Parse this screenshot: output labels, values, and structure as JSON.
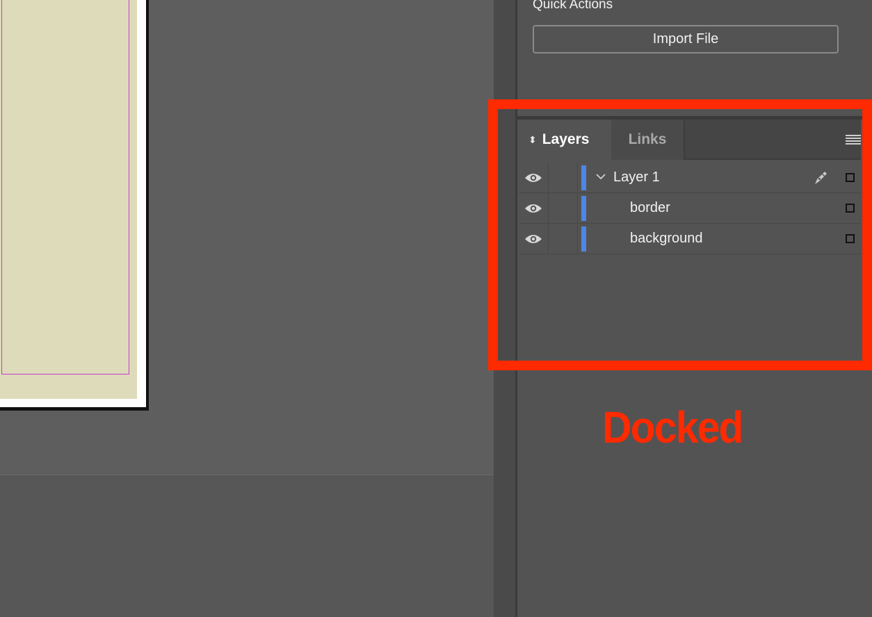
{
  "quick_actions": {
    "title": "Quick Actions",
    "import_button": "Import File"
  },
  "layers_panel": {
    "tabs": [
      {
        "label": "Layers",
        "active": true
      },
      {
        "label": "Links",
        "active": false
      }
    ],
    "layers": [
      {
        "name": "Layer 1",
        "expanded": true,
        "visible": true,
        "color": "#4f86e6"
      },
      {
        "name": "border",
        "visible": true,
        "color": "#4f86e6"
      },
      {
        "name": "background",
        "visible": true,
        "color": "#4f86e6"
      }
    ]
  },
  "annotation": {
    "label": "Docked",
    "color": "#ff2a00"
  }
}
